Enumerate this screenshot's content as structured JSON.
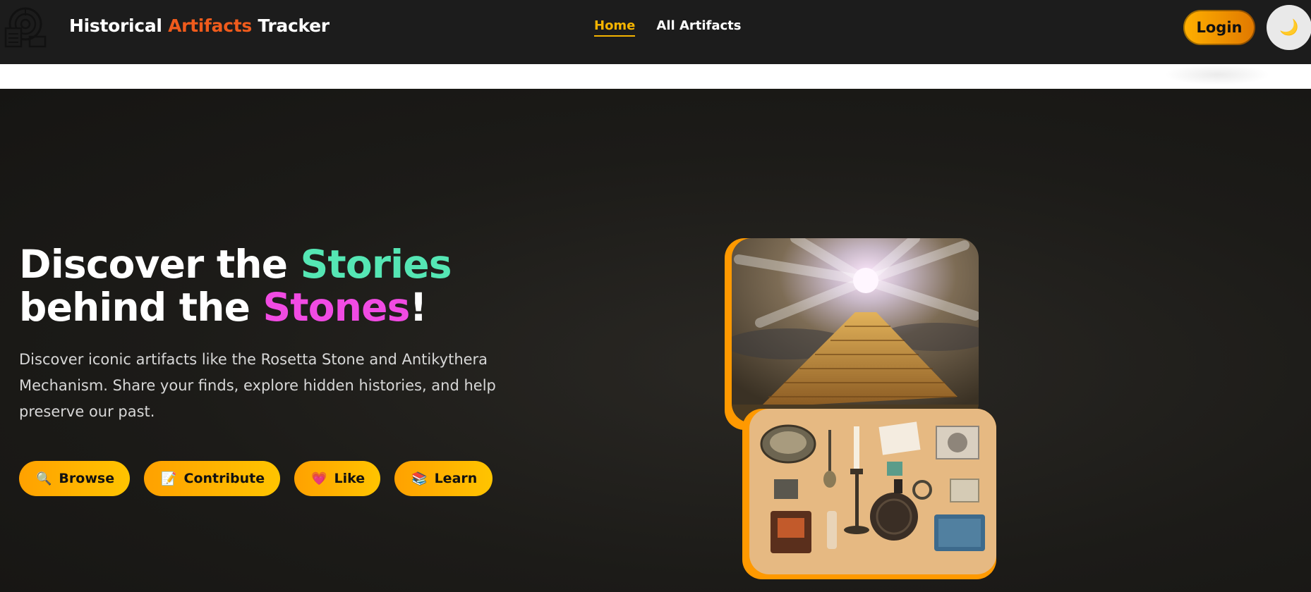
{
  "nav": {
    "brand_part1": "Historical ",
    "brand_accent": "Artifacts",
    "brand_part2": " Tracker",
    "links": [
      {
        "label": "Home",
        "active": true
      },
      {
        "label": "All Artifacts",
        "active": false
      }
    ],
    "login_label": "Login",
    "theme_icon": "🌙"
  },
  "hero": {
    "headline_a": "Discover the ",
    "headline_b": "Stories",
    "headline_c": "behind the ",
    "headline_d": "Stones",
    "headline_e": "!",
    "description": "Discover iconic artifacts like the Rosetta Stone and Antikythera Mechanism. Share your finds, explore hidden histories, and help preserve our past.",
    "buttons": [
      {
        "icon": "🔍",
        "label": "Browse"
      },
      {
        "icon": "📝",
        "label": "Contribute"
      },
      {
        "icon": "💗",
        "label": "Like"
      },
      {
        "icon": "📚",
        "label": "Learn"
      }
    ]
  },
  "colors": {
    "accent_orange": "#ef5b1c",
    "teal": "#55e6b4",
    "pink": "#f14be3",
    "gold": "#f5b400"
  }
}
